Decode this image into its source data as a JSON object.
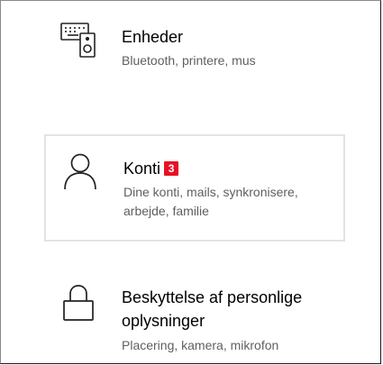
{
  "settings": {
    "tiles": [
      {
        "title": "Enheder",
        "description": "Bluetooth, printere, mus",
        "icon": "keyboard-speaker-icon"
      },
      {
        "title": "Konti",
        "badge": "3",
        "description": "Dine konti, mails, synkronisere, arbejde, familie",
        "icon": "person-icon"
      },
      {
        "title": "Beskyttelse af personlige oplysninger",
        "description": "Placering, kamera, mikrofon",
        "icon": "lock-icon"
      }
    ],
    "colors": {
      "badge": "#e81123",
      "selected_border": "#e3e3e3",
      "description_text": "#5f5f5f"
    }
  }
}
